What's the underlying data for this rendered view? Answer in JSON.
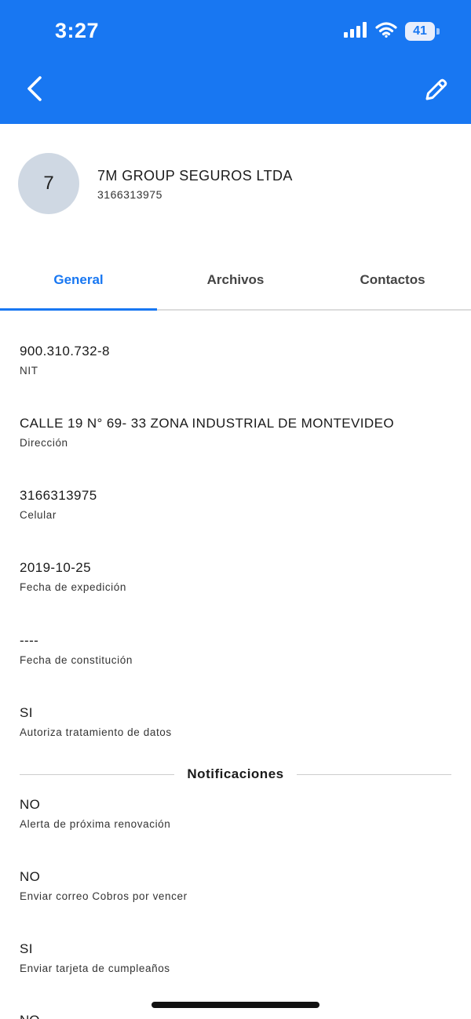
{
  "status_bar": {
    "time": "3:27",
    "battery": "41"
  },
  "header": {
    "back_icon": "chevron-left-icon",
    "edit_icon": "pencil-icon",
    "accent": "#1877f2"
  },
  "profile": {
    "avatar_text": "7",
    "name": "7M GROUP SEGUROS LTDA",
    "phone": "3166313975"
  },
  "tabs": [
    {
      "label": "General",
      "active": true
    },
    {
      "label": "Archivos",
      "active": false
    },
    {
      "label": "Contactos",
      "active": false
    }
  ],
  "fields": [
    {
      "value": "900.310.732-8",
      "label": "NIT"
    },
    {
      "value": "CALLE 19 N° 69- 33 ZONA INDUSTRIAL DE MONTEVIDEO",
      "label": "Dirección"
    },
    {
      "value": "3166313975",
      "label": "Celular"
    },
    {
      "value": "2019-10-25",
      "label": "Fecha de expedición"
    },
    {
      "value": "----",
      "label": "Fecha de constitución"
    },
    {
      "value": "SI",
      "label": "Autoriza tratamiento de datos"
    }
  ],
  "notifications": {
    "title": "Notificaciones",
    "fields": [
      {
        "value": "NO",
        "label": "Alerta de próxima renovación"
      },
      {
        "value": "NO",
        "label": "Enviar correo Cobros por vencer"
      },
      {
        "value": "SI",
        "label": "Enviar tarjeta de cumpleaños"
      }
    ],
    "partial_value": "NO"
  }
}
